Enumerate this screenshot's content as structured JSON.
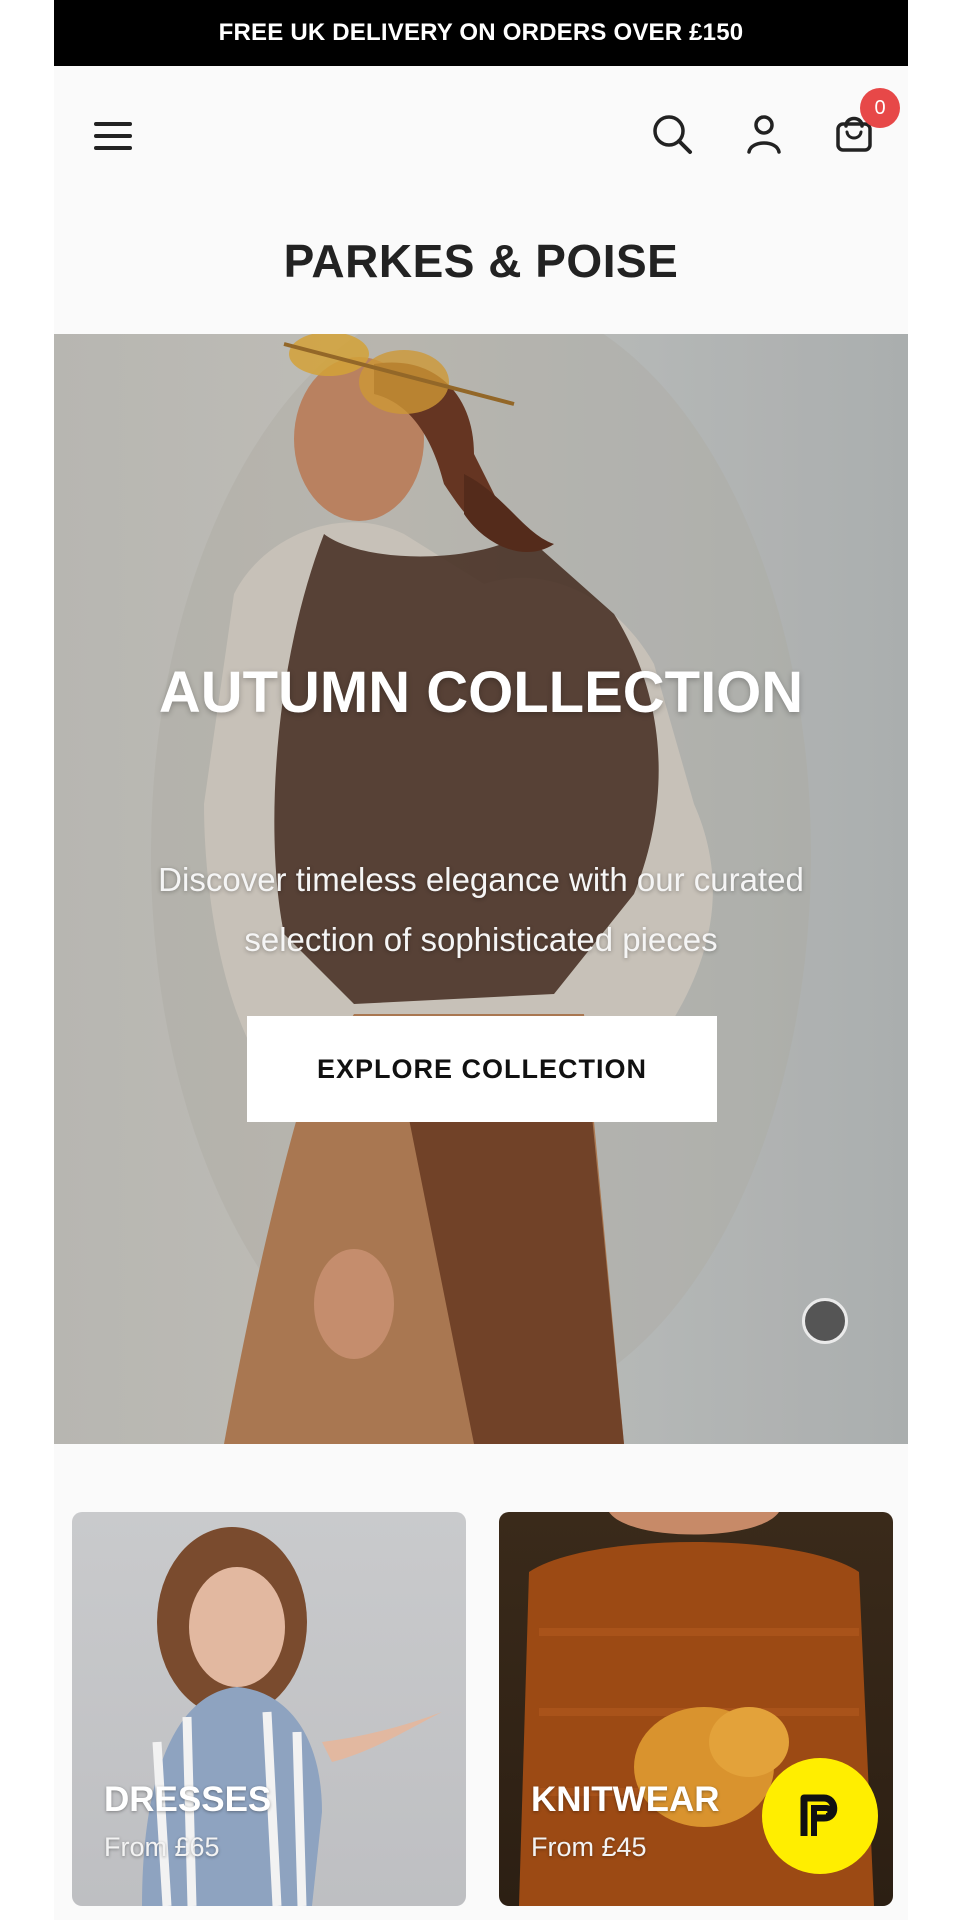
{
  "announcement": {
    "text": "FREE UK DELIVERY ON ORDERS OVER £150"
  },
  "header": {
    "brand": "PARKES & POISE",
    "cart_count": "0",
    "icons": [
      "menu-icon",
      "search-icon",
      "account-icon",
      "cart-icon"
    ]
  },
  "hero": {
    "title": "AUTUMN COLLECTION",
    "subtitle": "Discover timeless elegance with our curated selection of sophisticated pieces",
    "cta_label": "EXPLORE COLLECTION"
  },
  "categories": [
    {
      "title": "DRESSES",
      "price": "From £65"
    },
    {
      "title": "KNITWEAR",
      "price": "From £45"
    }
  ],
  "colors": {
    "announcement_bg": "#000000",
    "badge": "#e74848",
    "pay_badge": "#ffee00"
  }
}
